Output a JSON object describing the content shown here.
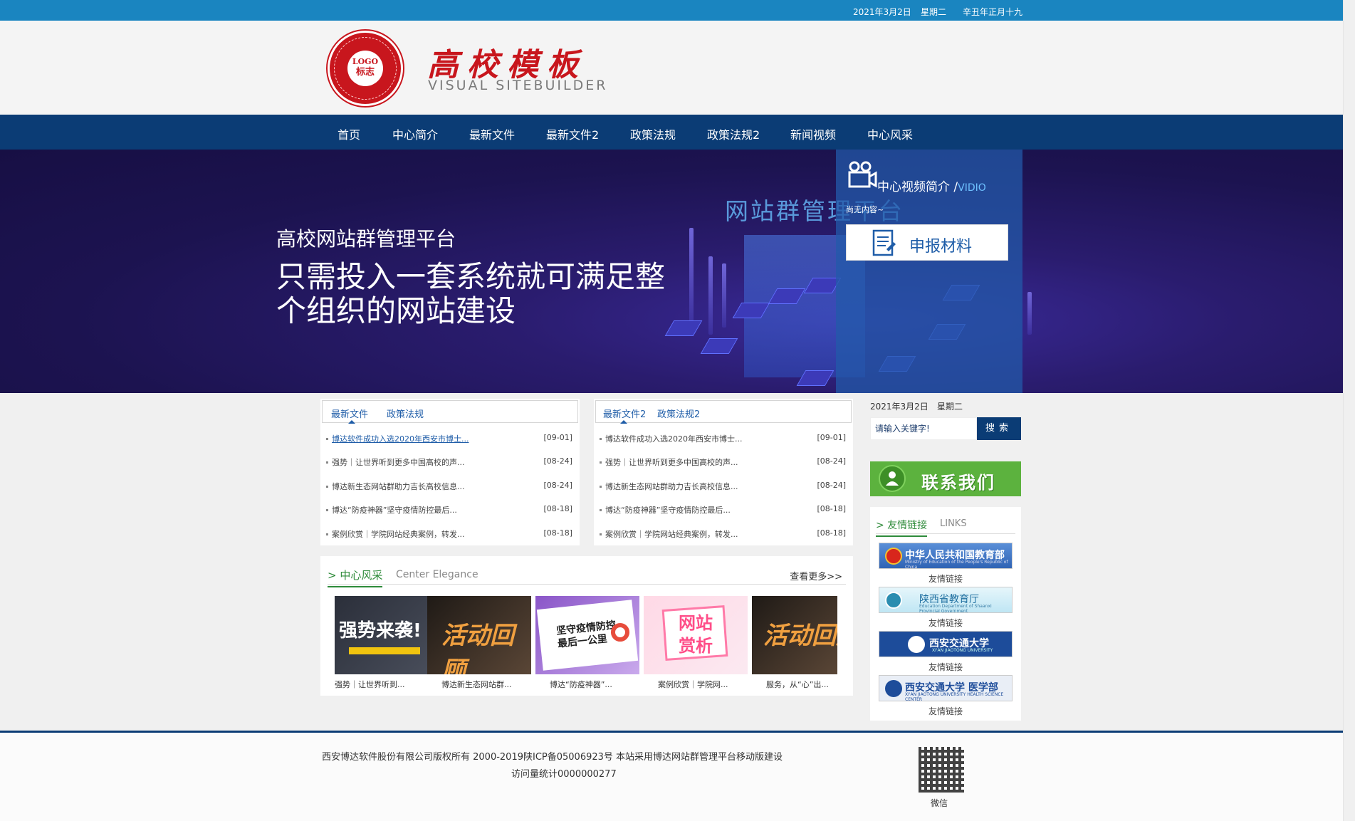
{
  "topbar": {
    "date": "2021年3月2日",
    "weekday": "星期二",
    "lunar": "辛丑年正月十九"
  },
  "header": {
    "logo_text": "LOGO",
    "logo_sub": "标志",
    "site_title": "高校模板",
    "site_subtitle": "VISUAL SITEBUILDER"
  },
  "nav": {
    "items": [
      "首页",
      "中心简介",
      "最新文件",
      "最新文件2",
      "政策法规",
      "政策法规2",
      "新闻视频",
      "中心风采"
    ]
  },
  "banner": {
    "small": "高校网站群管理平台",
    "big": "只需投入一套系统就可满足整个组织的网站建设",
    "platform": "网站群管理平台"
  },
  "video_panel": {
    "title": "中心视频简介 /",
    "title_en": "VIDIO",
    "empty": "尚无内容~",
    "apply_button": "申报材料"
  },
  "news1": {
    "tabs": [
      "最新文件",
      "政策法规"
    ],
    "rows": [
      {
        "title": "博达软件成功入选2020年西安市博士...",
        "date": "[09-01]"
      },
      {
        "title": "强势｜让世界听到更多中国高校的声...",
        "date": "[08-24]"
      },
      {
        "title": "博达新生态网站群助力吉长高校信息...",
        "date": "[08-24]"
      },
      {
        "title": "博达“防疫神器”坚守疫情防控最后...",
        "date": "[08-18]"
      },
      {
        "title": "案例欣赏｜学院网站经典案例，转发...",
        "date": "[08-18]"
      }
    ]
  },
  "news2": {
    "tabs": [
      "最新文件2",
      "政策法规2"
    ],
    "rows": [
      {
        "title": "博达软件成功入选2020年西安市博士...",
        "date": "[09-01]"
      },
      {
        "title": "强势｜让世界听到更多中国高校的声...",
        "date": "[08-24]"
      },
      {
        "title": "博达新生态网站群助力吉长高校信息...",
        "date": "[08-24]"
      },
      {
        "title": "博达“防疫神器”坚守疫情防控最后...",
        "date": "[08-18]"
      },
      {
        "title": "案例欣赏｜学院网站经典案例，转发...",
        "date": "[08-18]"
      }
    ]
  },
  "gallery": {
    "title": "> 中心风采",
    "title_en": "Center Elegance",
    "more": "查看更多>>",
    "items": [
      {
        "img_text": "强势来袭!",
        "caption": "强势｜让世界听到..."
      },
      {
        "img_text": "活动回顾",
        "caption": "博达新生态网站群..."
      },
      {
        "img_text": "坚守疫情防控最后一公里",
        "caption": "博达“防疫神器”..."
      },
      {
        "img_text": "网站赏析",
        "caption": "案例欣赏｜学院网..."
      },
      {
        "img_text": "活动回顾",
        "caption": "服务，从“心”出..."
      }
    ]
  },
  "sidebar": {
    "date": "2021年3月2日",
    "weekday": "星期二",
    "search_placeholder": "请输入关键字!",
    "search_button": "搜索",
    "contact": "联系我们",
    "links_title": "> 友情链接",
    "links_en": "LINKS",
    "links": [
      {
        "name": "中华人民共和国教育部",
        "sub": "Ministry of Education of the People's Republic of China",
        "caption": "友情链接"
      },
      {
        "name": "陕西省教育厅",
        "sub": "Education Department of Shaanxi Provincial Government",
        "caption": "友情链接"
      },
      {
        "name": "西安交通大学",
        "sub": "XI'AN JIAOTONG UNIVERSITY",
        "caption": "友情链接"
      },
      {
        "name": "西安交通大学 医学部",
        "sub": "XI'AN JIAOTONG UNIVERSITY HEALTH SCIENCE CENTER",
        "caption": "友情链接"
      }
    ]
  },
  "footer": {
    "copyright": "西安博达软件股份有限公司版权所有 2000-2019陕ICP备05006923号   本站采用博达网站群管理平台移动版建设",
    "visits": "访问量统计0000000277",
    "qr_caption": "微信"
  }
}
